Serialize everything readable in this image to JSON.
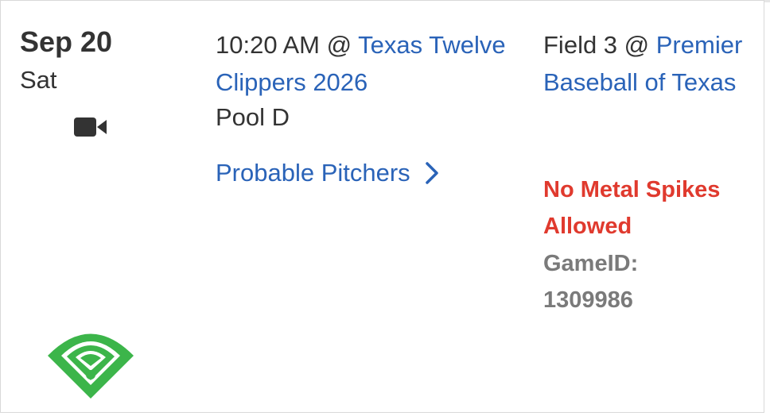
{
  "game": {
    "date": "Sep 20",
    "weekday": "Sat",
    "time_prefix": "10:20 AM @ ",
    "opponent": "Texas Twelve Clippers 2026",
    "pool": "Pool D",
    "probable_pitchers_label": "Probable Pitchers",
    "field_prefix": "Field 3 @ ",
    "venue": "Premier Baseball of Texas",
    "warning": "No Metal Spikes Allowed",
    "game_id_label": "GameID:",
    "game_id": "1309986"
  },
  "icons": {
    "video": "video-camera-icon",
    "chevron": "chevron-right-icon",
    "logo": "wifi-diamond-logo"
  },
  "colors": {
    "link": "#2a63b8",
    "warning": "#e03a2e",
    "muted": "#7a7a7a",
    "logo_green": "#3cb54a",
    "text": "#333333"
  }
}
